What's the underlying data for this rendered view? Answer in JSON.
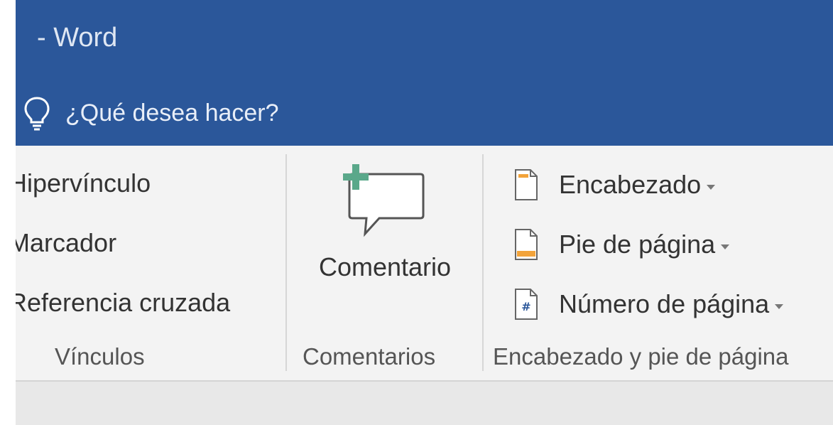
{
  "window": {
    "title": "- Word"
  },
  "tell_me": {
    "text": "¿Qué desea hacer?",
    "icon": "lightbulb-icon"
  },
  "ribbon": {
    "groups": {
      "links": {
        "label": "Vínculos",
        "items": {
          "hyperlink": "Hipervínculo",
          "bookmark": "Marcador",
          "cross_reference": "Referencia cruzada"
        }
      },
      "comments": {
        "label": "Comentarios",
        "new_comment": "Comentario",
        "icon": "new-comment-icon"
      },
      "header_footer": {
        "label": "Encabezado y pie de página",
        "items": {
          "header": "Encabezado",
          "footer": "Pie de página",
          "page_number": "Número de página"
        }
      }
    }
  },
  "colors": {
    "titlebar": "#2b579a",
    "ribbon": "#f3f3f3",
    "accent_green": "#5aa88a",
    "footer_orange": "#f2a33a",
    "page_number_blue": "#2b579a"
  }
}
